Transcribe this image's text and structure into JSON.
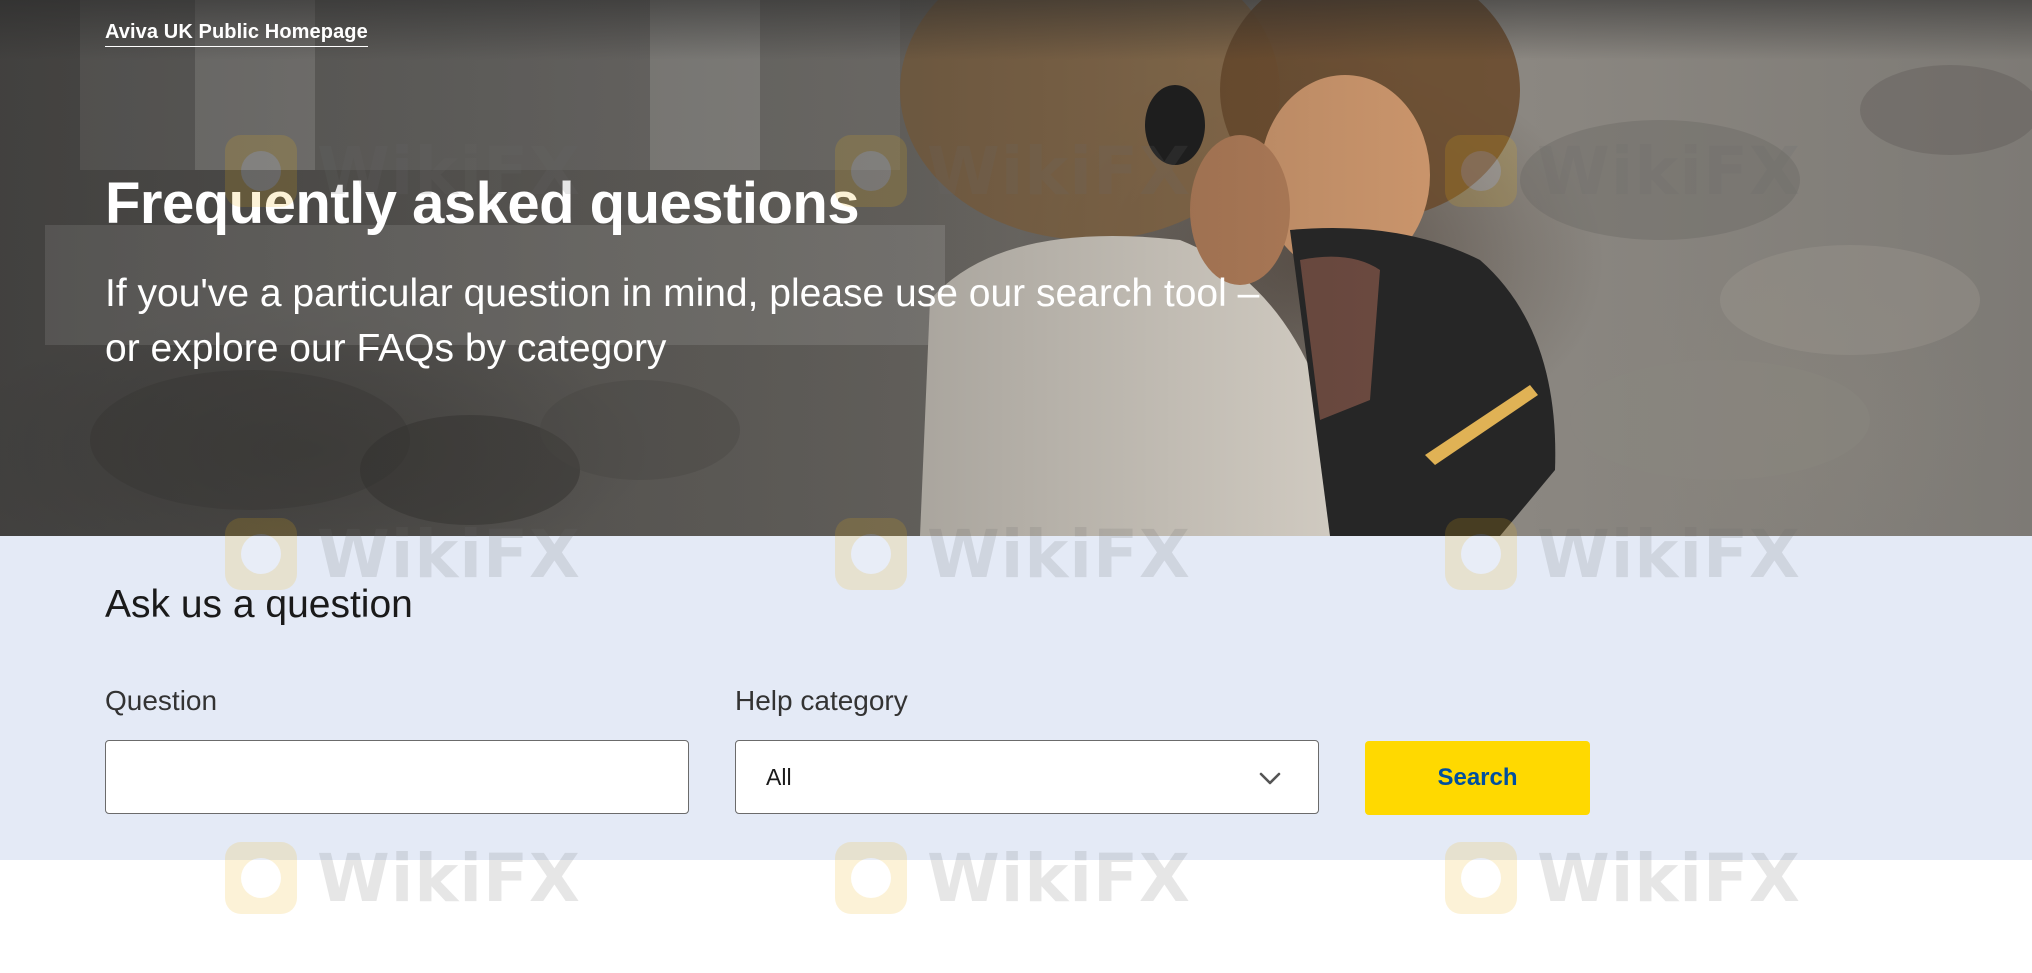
{
  "header": {
    "brand_link": "Aviva UK Public Homepage"
  },
  "hero": {
    "title": "Frequently asked questions",
    "subtitle": "If you've a particular question in mind, please use our search tool – or explore our FAQs by category"
  },
  "search": {
    "heading": "Ask us a question",
    "question_label": "Question",
    "question_value": "",
    "category_label": "Help category",
    "category_selected": "All",
    "button_label": "Search"
  },
  "watermark": {
    "text": "WikiFX"
  },
  "colors": {
    "panel_background": "#e4eaf6",
    "button_background": "#ffd900",
    "button_text": "#004f9f",
    "hero_text": "#ffffff"
  },
  "icons": {
    "dropdown": "chevron-down-icon"
  }
}
